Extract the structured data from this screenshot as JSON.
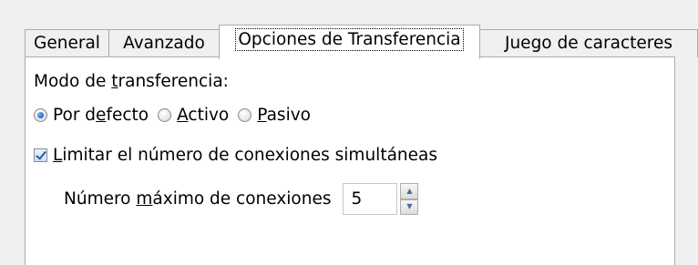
{
  "tabs": [
    {
      "label": "General",
      "active": false
    },
    {
      "label": "Avanzado",
      "active": false
    },
    {
      "label": "Opciones de Transferencia",
      "active": true
    },
    {
      "label": "Juego de caracteres",
      "active": false
    }
  ],
  "transfer": {
    "mode_label": "Modo de transferencia:",
    "modes": [
      {
        "label": "Por defecto",
        "checked": true
      },
      {
        "label": "Activo",
        "checked": false
      },
      {
        "label": "Pasivo",
        "checked": false
      }
    ]
  },
  "limit": {
    "label": "Limitar el número de conexiones simultáneas",
    "checked": true
  },
  "max_connections": {
    "label": "Número máximo de conexiones",
    "value": "5"
  },
  "icons": {
    "spin_up": "spin-up-arrow-icon",
    "spin_down": "spin-down-arrow-icon"
  }
}
